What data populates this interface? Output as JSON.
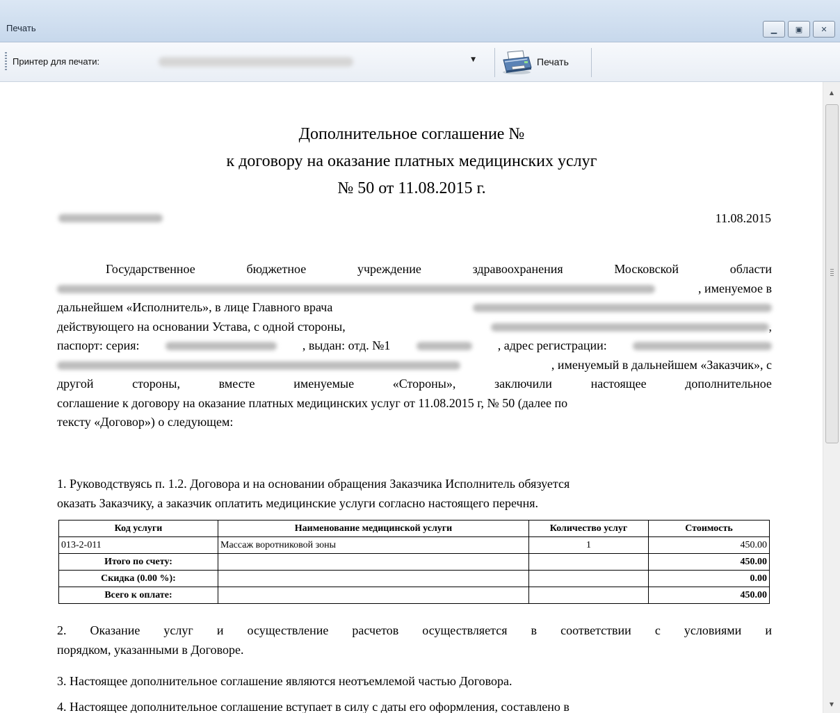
{
  "window": {
    "title": "Печать"
  },
  "toolbar": {
    "printer_label": "Принтер для печати:",
    "print_button": "Печать"
  },
  "document": {
    "title_line1": "Дополнительное соглашение №",
    "title_line2": "к договору на оказание платных медицинских услуг",
    "title_line3": "№ 50 от 11.08.2015 г.",
    "date": "11.08.2015",
    "p1_l1": [
      "Государственное",
      "бюджетное",
      "учреждение",
      "здравоохранения",
      "Московской",
      "области"
    ],
    "p1_l2_tail": ", именуемое в",
    "p1_l3_head": "дальнейшем «Исполнитель», в лице Главного врача",
    "p1_l4_head": "действующего на основании Устава, с одной стороны,",
    "p1_l4_tail": ",",
    "p1_l5_a": "паспорт: серия:",
    "p1_l5_b": ", выдан: отд. №1",
    "p1_l5_c": ", адрес регистрации:",
    "p1_l6_tail": ", именуемый в дальнейшем «Заказчик», с",
    "p1_l7": [
      "другой",
      "стороны,",
      "вместе",
      "именуемые",
      "«Стороны»,",
      "заключили",
      "настоящее",
      "дополнительное"
    ],
    "p1_l8": "соглашение к договору на оказание платных медицинских услуг от 11.08.2015 г, № 50 (далее по",
    "p1_l9": "тексту «Договор») о следующем:",
    "p2_l1": "1. Руководствуясь п. 1.2. Договора и на основании обращения Заказчика Исполнитель обязуется",
    "p2_l2": "оказать Заказчику, а заказчик оплатить медицинские услуги согласно настоящего перечня.",
    "p3_l1": [
      "2.",
      "Оказание",
      "услуг",
      "и",
      "осуществление",
      "расчетов",
      "осуществляется",
      "в",
      "соответствии",
      "с",
      "условиями",
      "и"
    ],
    "p3_l2": "порядком, указанными в Договоре.",
    "p4": "3. Настоящее дополнительное соглашение являются неотъемлемой частью Договора.",
    "p5": "4. Настоящее дополнительное соглашение вступает в силу с даты его оформления, составлено в"
  },
  "services_table": {
    "headers": [
      "Код услуги",
      "Наименование медицинской услуги",
      "Количество услуг",
      "Стоимость"
    ],
    "rows": [
      {
        "code": "013-2-011",
        "name": "Массаж воротниковой зоны",
        "qty": "1",
        "cost": "450.00"
      }
    ],
    "summary": [
      {
        "label": "Итого по счету:",
        "value": "450.00"
      },
      {
        "label": "Скидка (0.00 %):",
        "value": "0.00"
      },
      {
        "label": "Всего к оплате:",
        "value": "450.00"
      }
    ]
  }
}
